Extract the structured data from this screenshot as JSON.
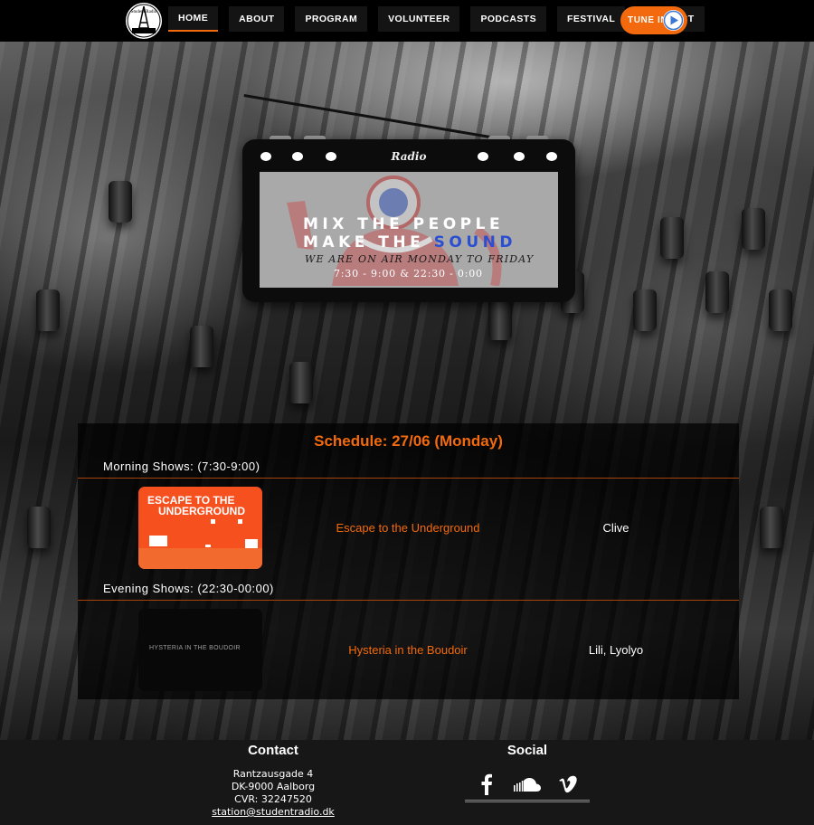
{
  "nav": {
    "logo_alt": "Student Radio Aalborg 93.2",
    "items": [
      {
        "label": "HOME"
      },
      {
        "label": "ABOUT"
      },
      {
        "label": "PROGRAM"
      },
      {
        "label": "VOLUNTEER"
      },
      {
        "label": "PODCASTS"
      },
      {
        "label": "FESTIVAL"
      },
      {
        "label": "CONTACT"
      }
    ],
    "active_item": "HOME",
    "tune_in_label": "TUNE IN"
  },
  "radio": {
    "label": "Radio",
    "line1": "MIX THE PEOPLE",
    "line2_prefix": "MAKE THE ",
    "line2_highlight": "SOUND",
    "line3": "WE ARE ON AIR MONDAY TO FRIDAY",
    "line4": "7:30 - 9:00 & 22:30 - 0:00"
  },
  "schedule": {
    "title": "Schedule: 27/06 (Monday)",
    "sections": [
      {
        "label": "Morning Shows: (7:30-9:00)",
        "show": {
          "thumb_line1": "ESCAPE TO THE",
          "thumb_line2": "UNDERGROUND",
          "title": "Escape to the Underground",
          "host": "Clive"
        }
      },
      {
        "label": "Evening Shows: (22:30-00:00)",
        "show": {
          "thumb_text": "HYSTERIA IN THE BOUDOIR",
          "title": "Hysteria in the Boudoir",
          "host": "Lili, Lyolyo"
        }
      }
    ]
  },
  "footer": {
    "contact": {
      "heading": "Contact",
      "address": "Rantzausgade 4",
      "city": "DK-9000 Aalborg",
      "cvr": "CVR: 32247520",
      "email": "station@studentradio.dk"
    },
    "social": {
      "heading": "Social",
      "icons": [
        "facebook-icon",
        "soundcloud-icon",
        "vimeo-icon"
      ]
    }
  },
  "colors": {
    "accent": "#f26a0d",
    "footer_bg": "#171717",
    "nav_bg": "#000000"
  }
}
